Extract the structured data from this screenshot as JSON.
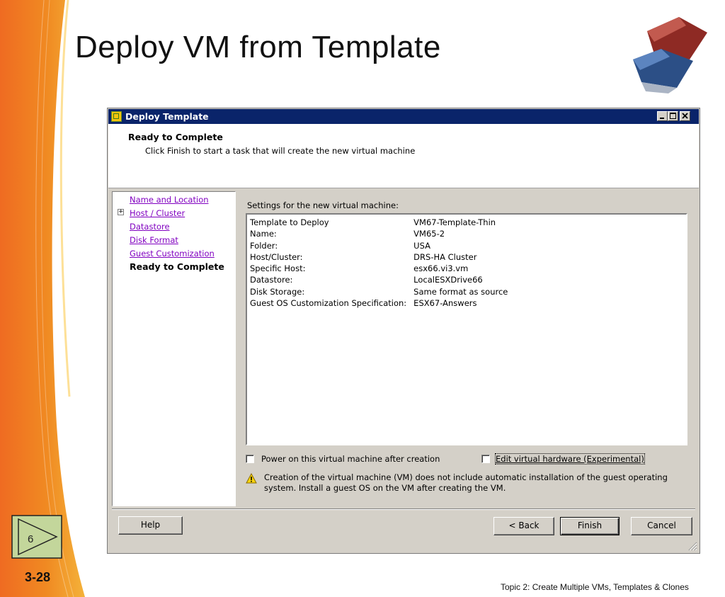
{
  "slide": {
    "title": "Deploy VM from Template",
    "number_badge": "6",
    "page_number": "3-28",
    "footer": "Topic 2:  Create Multiple VMs, Templates & Clones"
  },
  "window": {
    "title": "Deploy Template",
    "icon": "vsphere-deploy-icon",
    "controls": [
      "minimize",
      "maximize",
      "close"
    ]
  },
  "header": {
    "title": "Ready to Complete",
    "subtitle": "Click Finish to start a task that will create the new virtual machine"
  },
  "nav": {
    "items": [
      {
        "label": "Name and Location",
        "current": false
      },
      {
        "label": "Host / Cluster",
        "current": false,
        "expandable": true
      },
      {
        "label": "Datastore",
        "current": false
      },
      {
        "label": "Disk Format",
        "current": false
      },
      {
        "label": "Guest Customization",
        "current": false
      },
      {
        "label": "Ready to Complete",
        "current": true
      }
    ],
    "expander_glyph": "+"
  },
  "content": {
    "settings_label": "Settings for the new virtual machine:",
    "rows": [
      {
        "key": "Template to Deploy",
        "value": "VM67-Template-Thin"
      },
      {
        "key": "Name:",
        "value": "VM65-2"
      },
      {
        "key": "Folder:",
        "value": "USA"
      },
      {
        "key": "Host/Cluster:",
        "value": "DRS-HA Cluster"
      },
      {
        "key": "Specific Host:",
        "value": "esx66.vi3.vm"
      },
      {
        "key": "Datastore:",
        "value": "LocalESXDrive66"
      },
      {
        "key": "Disk Storage:",
        "value": "Same format as source"
      },
      {
        "key": "Guest OS Customization Specification:",
        "value": "ESX67-Answers"
      }
    ],
    "power_on_label": "Power on this virtual machine after creation",
    "power_on_checked": false,
    "edit_hw_label": "Edit virtual hardware (Experimental)",
    "edit_hw_checked": false,
    "warning": "Creation of the virtual machine (VM) does not include automatic installation of the guest operating system. Install a guest OS on the VM after creating the VM."
  },
  "buttons": {
    "help": "Help",
    "back": "< Back",
    "finish": "Finish",
    "cancel": "Cancel"
  },
  "colors": {
    "titlebar": "#0a246a",
    "dialog_bg": "#d4d0c8",
    "visited_link": "#8000c0",
    "slide_accent_orange": "#f07a21",
    "badge_green": "#c3d69b"
  }
}
